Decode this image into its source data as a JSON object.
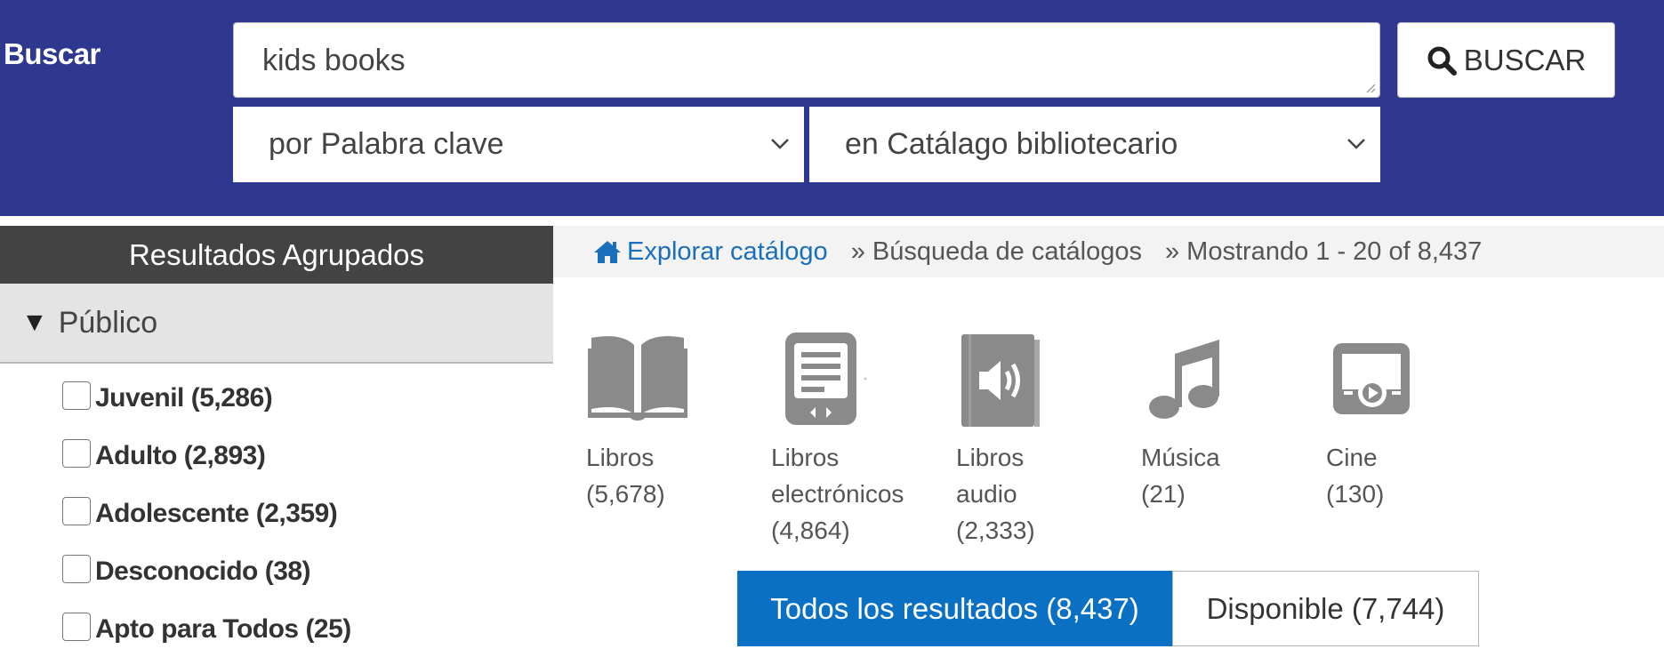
{
  "search": {
    "label": "Buscar",
    "query": "kids books",
    "button_label": "BUSCAR",
    "type_select": "por Palabra clave",
    "scope_select": "en Catálago bibliotecario"
  },
  "facets": {
    "header": "Resultados Agrupados",
    "group_label": "Público",
    "items": [
      {
        "label": "Juvenil (5,286)"
      },
      {
        "label": "Adulto (2,893)"
      },
      {
        "label": "Adolescente (2,359)"
      },
      {
        "label": "Desconocido (38)"
      },
      {
        "label": "Apto para Todos (25)"
      }
    ]
  },
  "breadcrumb": {
    "home": "Explorar catálogo",
    "search": "» Búsqueda de catálogos",
    "showing": "» Mostrando 1 - 20 of 8,437"
  },
  "formats": [
    {
      "icon": "book-icon",
      "line1": "Libros",
      "line2": "(5,678)",
      "line3": ""
    },
    {
      "icon": "ebook-icon",
      "line1": "Libros",
      "line2": "electrónicos",
      "line3": "(4,864)"
    },
    {
      "icon": "audiobook-icon",
      "line1": "Libros",
      "line2": "audio",
      "line3": "(2,333)"
    },
    {
      "icon": "music-note-icon",
      "line1": "Música",
      "line2": "(21)",
      "line3": ""
    },
    {
      "icon": "film-icon",
      "line1": "Cine",
      "line2": "(130)",
      "line3": ""
    }
  ],
  "tabs": {
    "all": "Todos los resultados (8,437)",
    "available": "Disponible (7,744)"
  },
  "colors": {
    "header_bg": "#2e388e",
    "facet_header_bg": "#434343",
    "accent_blue": "#0a70c4",
    "link_blue": "#1a6fbb",
    "icon_gray": "#8a8a8a"
  }
}
